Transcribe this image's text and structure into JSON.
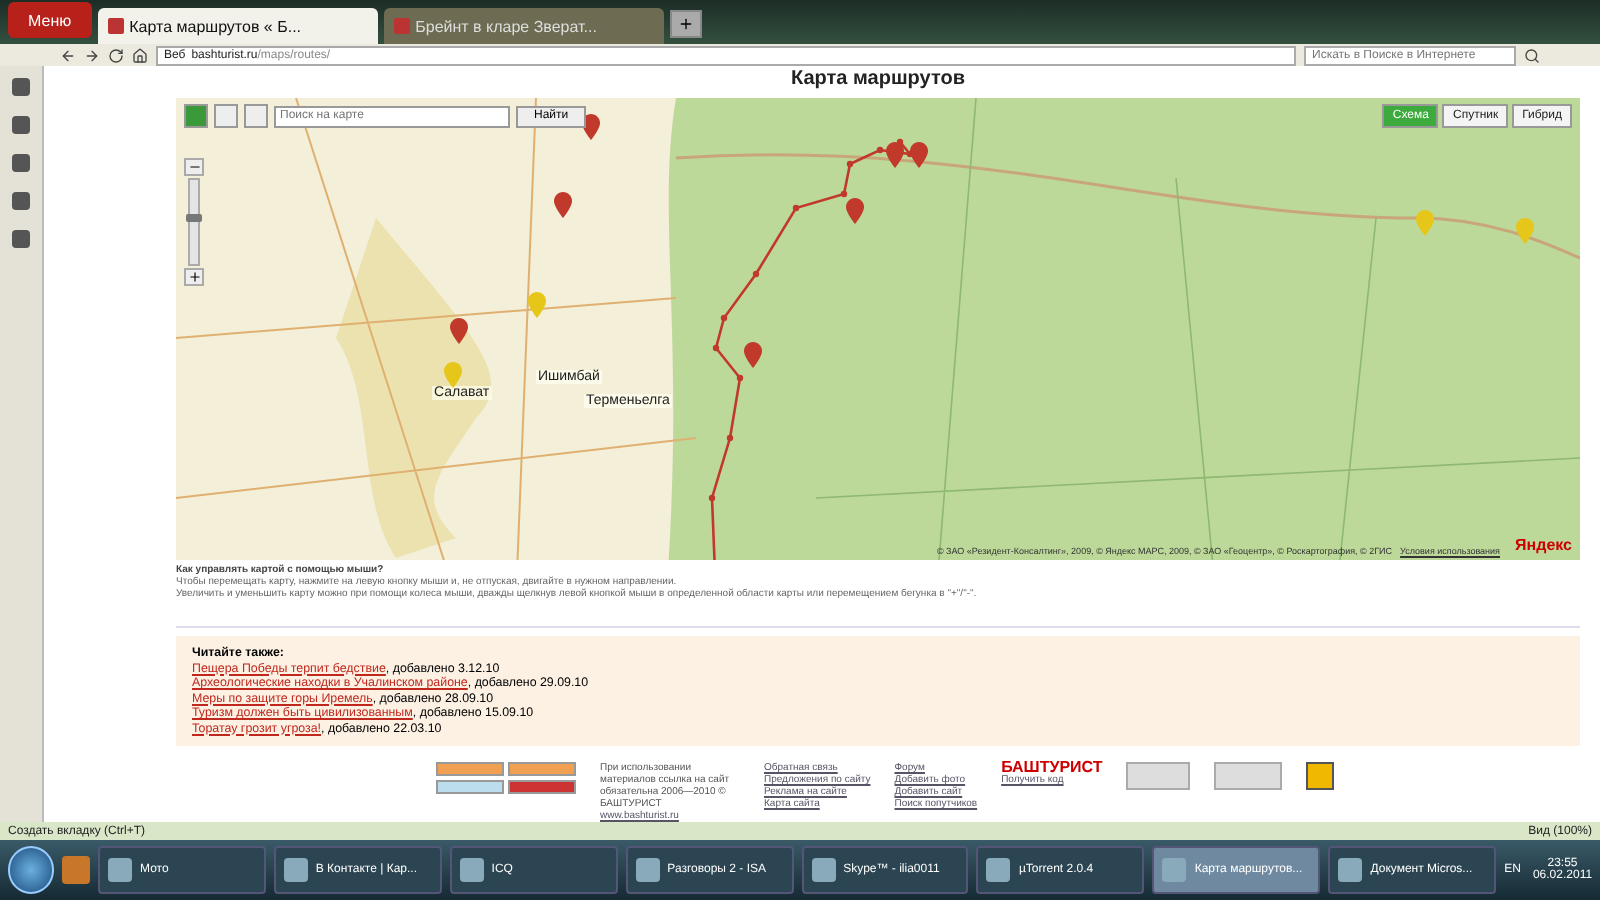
{
  "browser": {
    "menu_label": "Меню",
    "tabs": [
      {
        "label": "Карта маршрутов « Б...",
        "selected": true
      },
      {
        "label": "Брейнт в кларе Зверат...",
        "selected": false
      }
    ],
    "address": {
      "site_label": "Веб",
      "url_host": "bashturist.ru",
      "url_path": "/maps/routes/"
    },
    "search": {
      "placeholder": "Искать в Поиске в Интернете"
    }
  },
  "page": {
    "title": "Карта маршрутов",
    "map": {
      "search_placeholder": "Поиск на карте",
      "search_button": "Найти",
      "zoom": {
        "level": 0.55
      },
      "layers": [
        {
          "label": "Схема",
          "selected": true
        },
        {
          "label": "Спутник",
          "selected": false
        },
        {
          "label": "Гибрид",
          "selected": false
        }
      ],
      "places": [
        "Ишимбай",
        "Салават",
        "Терменьелга"
      ],
      "markers": [
        {
          "color": "#c0392b"
        },
        {
          "color": "#c0392b"
        },
        {
          "color": "#c0392b"
        },
        {
          "color": "#c0392b"
        },
        {
          "color": "#c0392b"
        },
        {
          "color": "#c0392b"
        },
        {
          "color": "#c0392b"
        },
        {
          "color": "#e6c619"
        },
        {
          "color": "#e6c619"
        },
        {
          "color": "#e6c619"
        },
        {
          "color": "#e6c619"
        }
      ],
      "copyright": "© ЗАО «Резидент-Консалтинг», 2009, © Яндекс МАРС, 2009, © ЗАО «Геоцентр», © Роскартография, © 2ГИС",
      "terms": "Условия использования",
      "logo": "Яндекс"
    },
    "help": {
      "title": "Как управлять картой с помощью мыши?",
      "lines": [
        "Чтобы перемещать карту, нажмите на левую кнопку мыши и, не отпуская, двигайте в нужном направлении.",
        "Увеличить и уменьшить карту можно при помощи колеса мыши, дважды щелкнув левой кнопкой мыши в определенной области карты или перемещением бегунка в \"+\"/\"-\"."
      ]
    },
    "read_also": {
      "title": "Читайте также:",
      "items": [
        {
          "link": "Пещера Победы терпит бедствие",
          "added": ", добавлено 3.12.10"
        },
        {
          "link": "Археологические находки в Учалинском районе",
          "added": ", добавлено 29.09.10"
        },
        {
          "link": "Меры по защите горы Иремель",
          "added": ", добавлено 28.09.10"
        },
        {
          "link": "Туризм должен быть цивилизованным",
          "added": ", добавлено 15.09.10"
        },
        {
          "link": "Торатау грозит угроза!",
          "added": ", добавлено 22.03.10"
        }
      ]
    },
    "footer": {
      "notice": "При использовании материалов ссылка на сайт обязательна 2006—2010 © БАШТУРИСТ",
      "site": "www.bashturist.ru",
      "links_1": [
        "Обратная связь",
        "Предложения по сайту",
        "Реклама на сайте",
        "Карта сайта"
      ],
      "links_2": [
        "Форум",
        "Добавить фото",
        "Добавить сайт",
        "Поиск попутчиков"
      ],
      "logo": "БАШТУРИСТ",
      "get_code": "Получить код"
    }
  },
  "status_bar": {
    "new_tab": "Создать вкладку (Ctrl+T)",
    "zoom": "Вид (100%)"
  },
  "taskbar": {
    "items": [
      {
        "label": "Мото",
        "selected": false
      },
      {
        "label": "В Контакте | Кар...",
        "selected": false
      },
      {
        "label": "ICQ",
        "selected": false
      },
      {
        "label": "Разговоры 2 - ISA",
        "selected": false
      },
      {
        "label": "Skype™ - ilia0011",
        "selected": false
      },
      {
        "label": "µTorrent 2.0.4",
        "selected": false
      },
      {
        "label": "Карта маршрутов...",
        "selected": true
      },
      {
        "label": "Документ Micros...",
        "selected": false
      }
    ],
    "lang": "EN",
    "time": "23:55",
    "date": "06.02.2011"
  }
}
